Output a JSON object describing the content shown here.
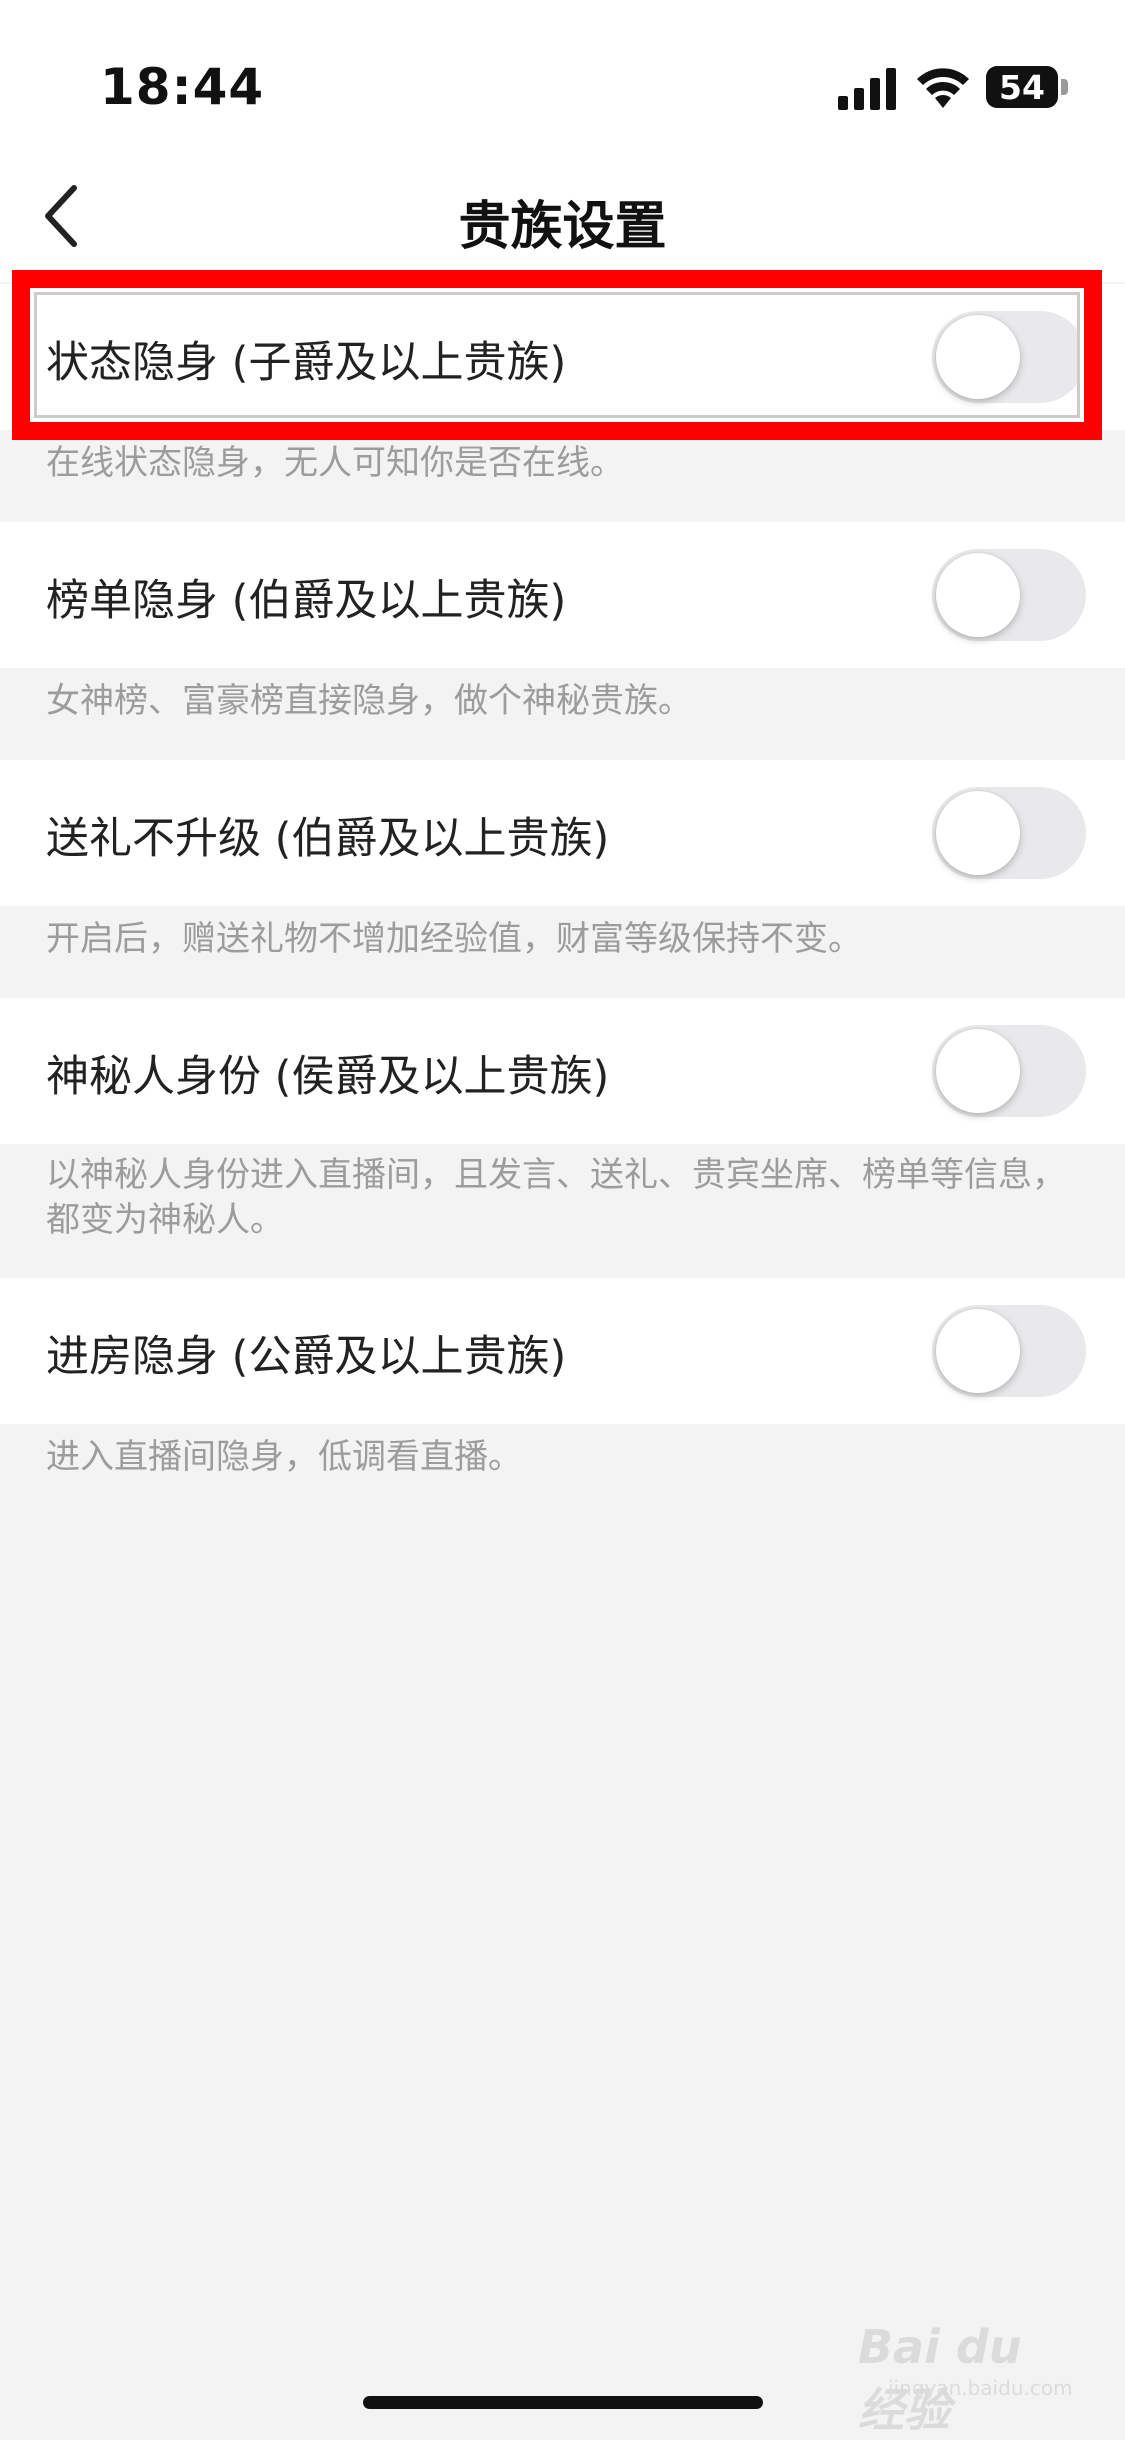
{
  "status_bar": {
    "time": "18:44",
    "battery": "54",
    "signal_icon": "signal-bars-icon",
    "wifi_icon": "wifi-icon",
    "battery_icon": "battery-icon"
  },
  "nav": {
    "title": "贵族设置",
    "back_icon": "chevron-left-icon"
  },
  "settings": [
    {
      "label": "状态隐身 (子爵及以上贵族)",
      "description": "在线状态隐身，无人可知你是否在线。",
      "enabled": false
    },
    {
      "label": "榜单隐身 (伯爵及以上贵族)",
      "description": "女神榜、富豪榜直接隐身，做个神秘贵族。",
      "enabled": false
    },
    {
      "label": "送礼不升级 (伯爵及以上贵族)",
      "description": "开启后，赠送礼物不增加经验值，财富等级保持不变。",
      "enabled": false
    },
    {
      "label": "神秘人身份 (侯爵及以上贵族)",
      "description": "以神秘人身份进入直播间，且发言、送礼、贵宾坐席、榜单等信息，都变为神秘人。",
      "enabled": false
    },
    {
      "label": "进房隐身 (公爵及以上贵族)",
      "description": "进入直播间隐身，低调看直播。",
      "enabled": false
    }
  ],
  "highlight_color": "#ff0000",
  "watermark": {
    "main": "Bai du 经验",
    "sub": "jingyan.baidu.com"
  }
}
